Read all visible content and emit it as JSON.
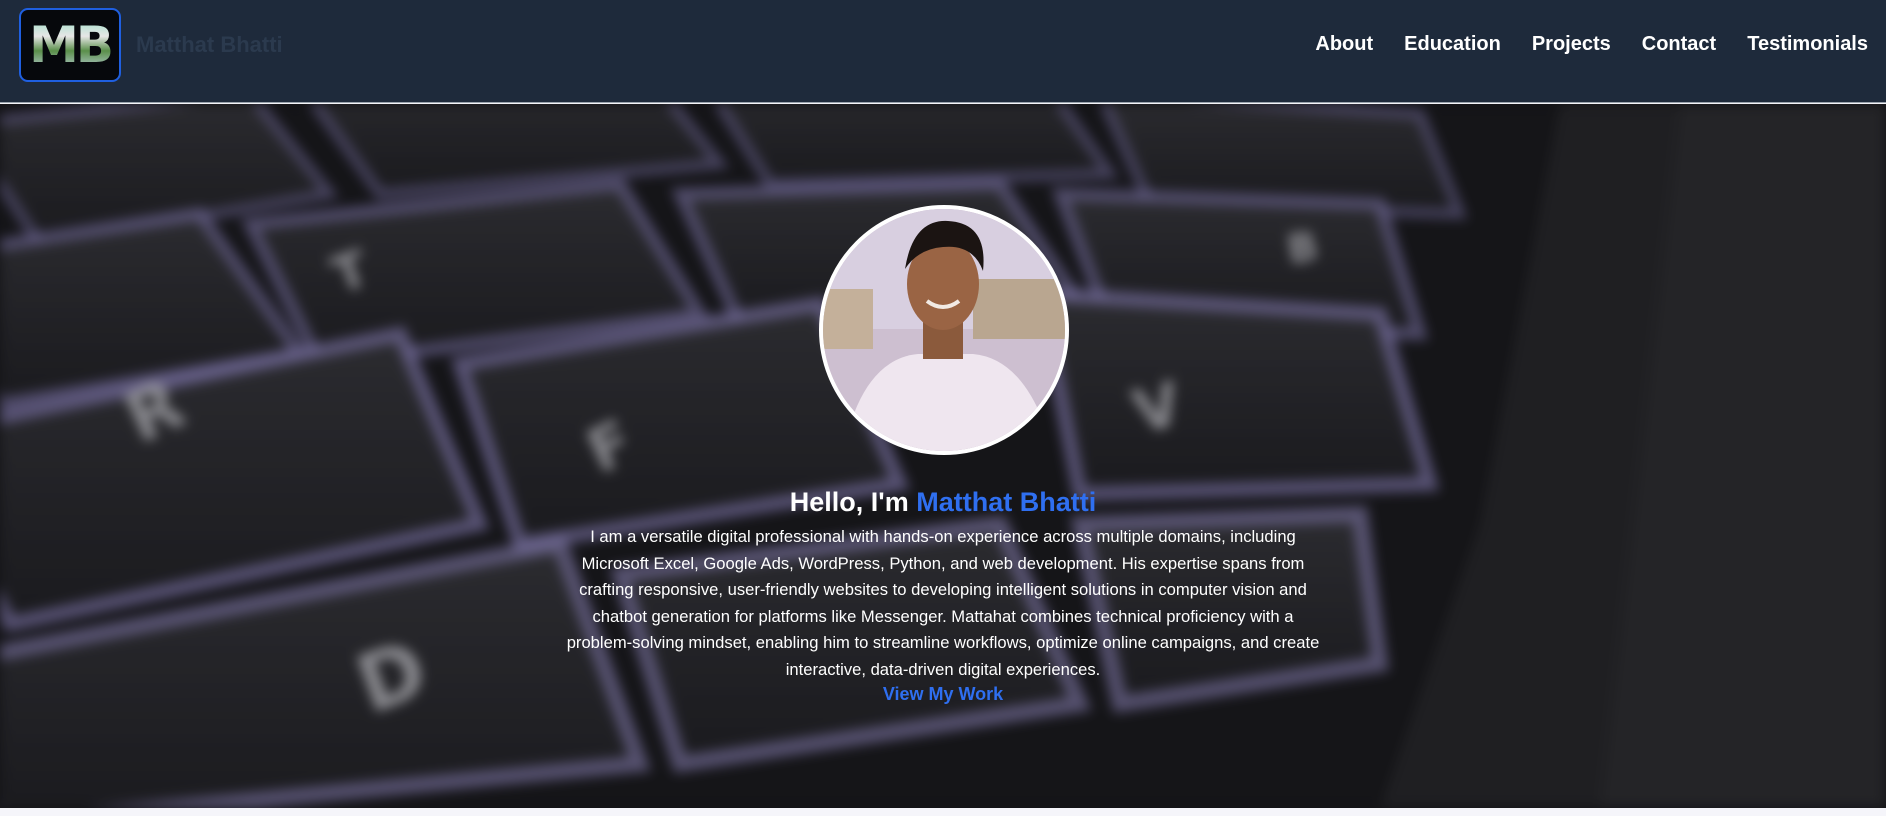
{
  "header": {
    "logo_text": "MB",
    "brand_name": "Matthat Bhatti",
    "nav": [
      {
        "label": "About"
      },
      {
        "label": "Education"
      },
      {
        "label": "Projects"
      },
      {
        "label": "Contact"
      },
      {
        "label": "Testimonials"
      }
    ]
  },
  "hero": {
    "title_prefix": "Hello, I'm ",
    "title_name": "Matthat Bhatti",
    "description": "I am a versatile digital professional with hands-on experience across multiple domains, including Microsoft Excel, Google Ads, WordPress, Python, and web development. His expertise spans from crafting responsive, user-friendly websites to developing intelligent solutions in computer vision and chatbot generation for platforms like Messenger. Mattahat combines technical proficiency with a problem-solving mindset, enabling him to streamline workflows, optimize online campaigns, and create interactive, data-driven digital experiences.",
    "cta_label": "View My Work"
  },
  "colors": {
    "header_bg": "#1e2a3b",
    "accent": "#2f6ff0",
    "text": "#ffffff"
  }
}
